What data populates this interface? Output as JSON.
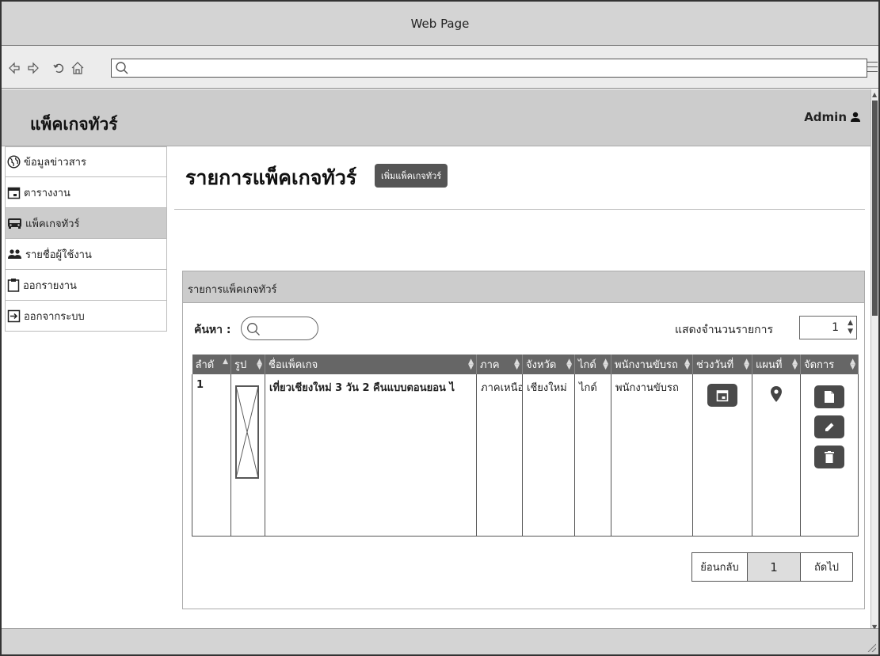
{
  "window": {
    "title": "Web Page"
  },
  "browser": {
    "url_value": ""
  },
  "app": {
    "title": "แพ็คเกจทัวร์",
    "user": "Admin"
  },
  "sidebar": {
    "items": [
      {
        "label": "ข้อมูลข่าวสาร",
        "icon": "globe-icon",
        "active": false
      },
      {
        "label": "ตารางงาน",
        "icon": "calendar-icon",
        "active": false
      },
      {
        "label": "แพ็คเกจทัวร์",
        "icon": "car-icon",
        "active": true
      },
      {
        "label": "รายชื่อผู้ใช้งาน",
        "icon": "users-icon",
        "active": false
      },
      {
        "label": "ออกรายงาน",
        "icon": "clipboard-icon",
        "active": false
      },
      {
        "label": "ออกจากระบบ",
        "icon": "logout-icon",
        "active": false
      }
    ]
  },
  "main": {
    "heading": "รายการแพ็คเกจทัวร์",
    "add_button": "เพิ่มแพ็คเกจทัวร์",
    "panel_title": "รายการแพ็คเกจทัวร์",
    "search_label": "ค้นหา :",
    "search_value": "",
    "show_label": "แสดงจำนวนรายการ",
    "show_count": "1",
    "table": {
      "headers": [
        "ลำดั",
        "รูป",
        "ชื่อแพ็คเกจ",
        "ภาค",
        "จังหวัด",
        "ไกด์",
        "พนักงานขับรถ",
        "ช่วงวันที่",
        "แผนที่",
        "จัดการ"
      ],
      "row": {
        "no": "1",
        "name": "เที่ยวเชียงใหม่ 3 วัน 2 คืนแบบตอนยอน ไ",
        "region": "ภาคเหนือ",
        "province": "เชียงใหม่",
        "guide": "ไกด์",
        "driver": "พนักงานขับรถ"
      }
    },
    "pager": {
      "prev": "ย้อนกลับ",
      "page": "1",
      "next": "ถัดไป"
    }
  }
}
